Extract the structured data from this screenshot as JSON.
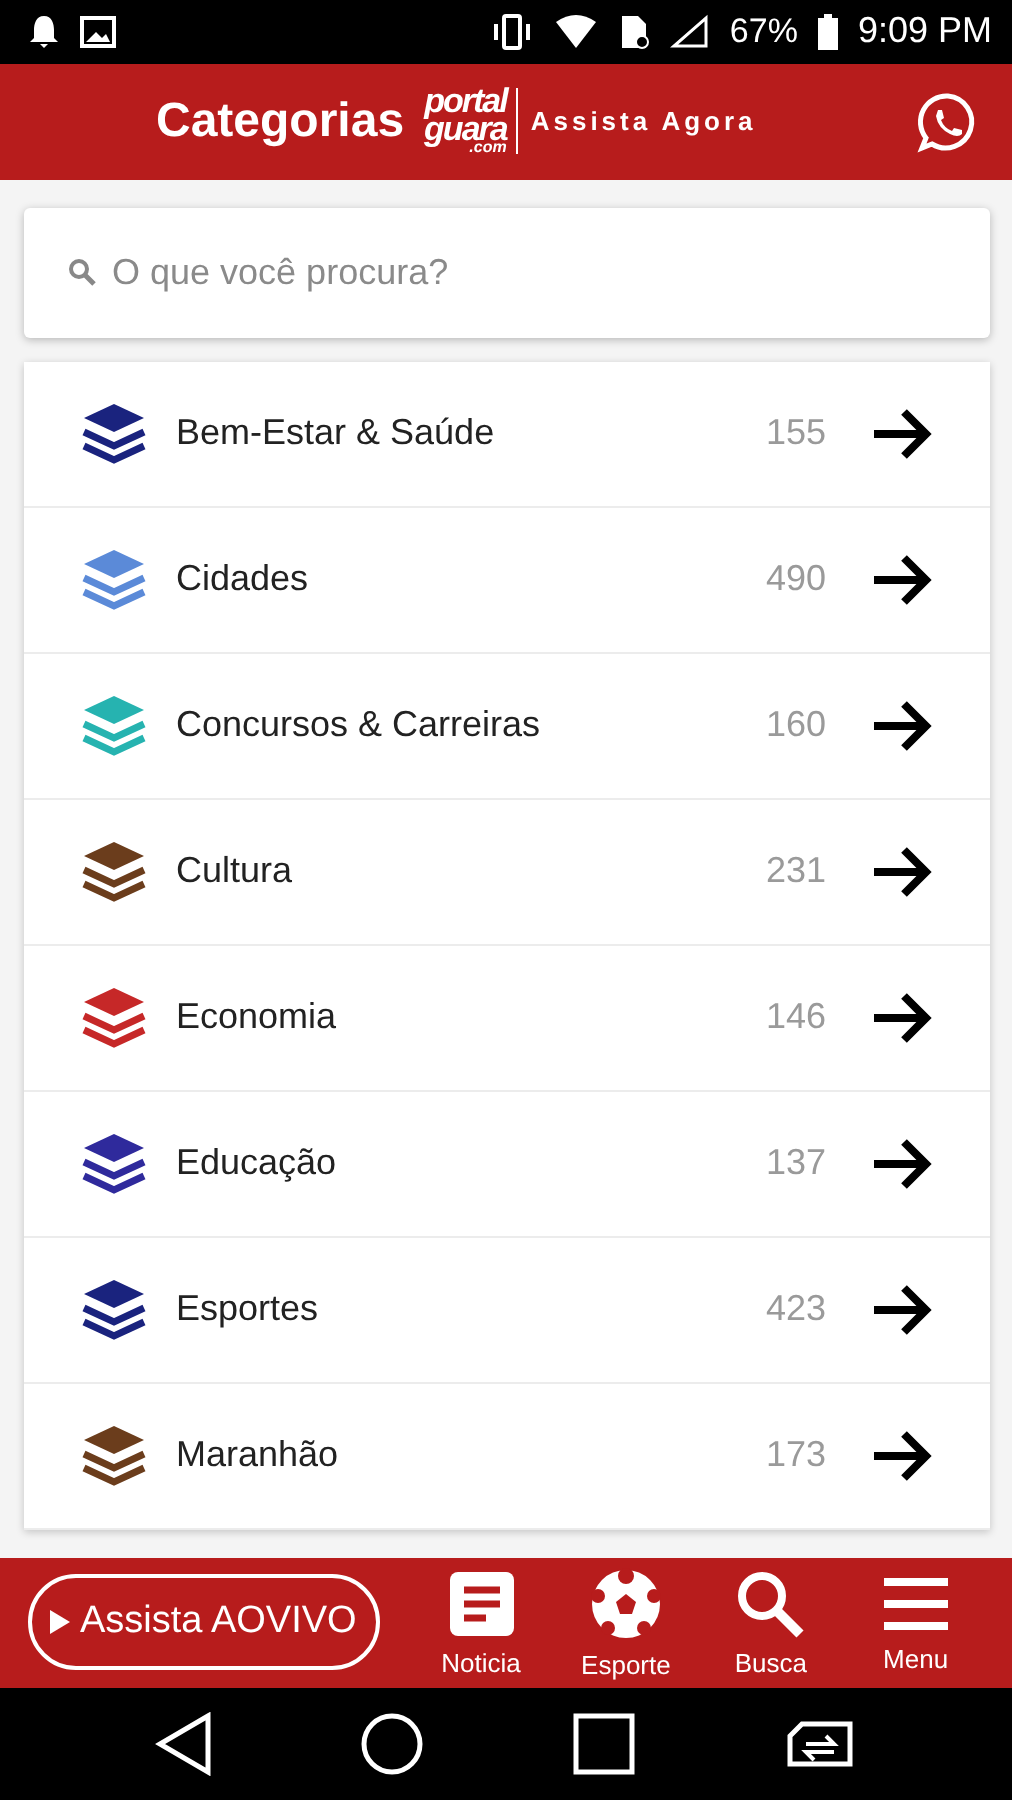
{
  "status_bar": {
    "battery": "67%",
    "time": "9:09 PM"
  },
  "header": {
    "title": "Categorias",
    "logo": {
      "top": "portal",
      "bottom": "guara",
      "suffix": ".com"
    },
    "tagline": "Assista Agora"
  },
  "search": {
    "placeholder": "O que você procura?"
  },
  "categories": [
    {
      "name": "Bem-Estar & Saúde",
      "count": "155",
      "color": "#1a237e"
    },
    {
      "name": "Cidades",
      "count": "490",
      "color": "#5b8ad8"
    },
    {
      "name": "Concursos & Carreiras",
      "count": "160",
      "color": "#26b3b0"
    },
    {
      "name": "Cultura",
      "count": "231",
      "color": "#6b3d1c"
    },
    {
      "name": "Economia",
      "count": "146",
      "color": "#c62828"
    },
    {
      "name": "Educação",
      "count": "137",
      "color": "#2f2a9c"
    },
    {
      "name": "Esportes",
      "count": "423",
      "color": "#1a237e"
    },
    {
      "name": "Maranhão",
      "count": "173",
      "color": "#6b3d1c"
    }
  ],
  "bottom_nav": {
    "live_button": "Assista AOVIVO",
    "items": [
      {
        "kind": "news",
        "label": "Noticia"
      },
      {
        "kind": "sport",
        "label": "Esporte"
      },
      {
        "kind": "search",
        "label": "Busca"
      },
      {
        "kind": "menu",
        "label": "Menu"
      }
    ]
  }
}
